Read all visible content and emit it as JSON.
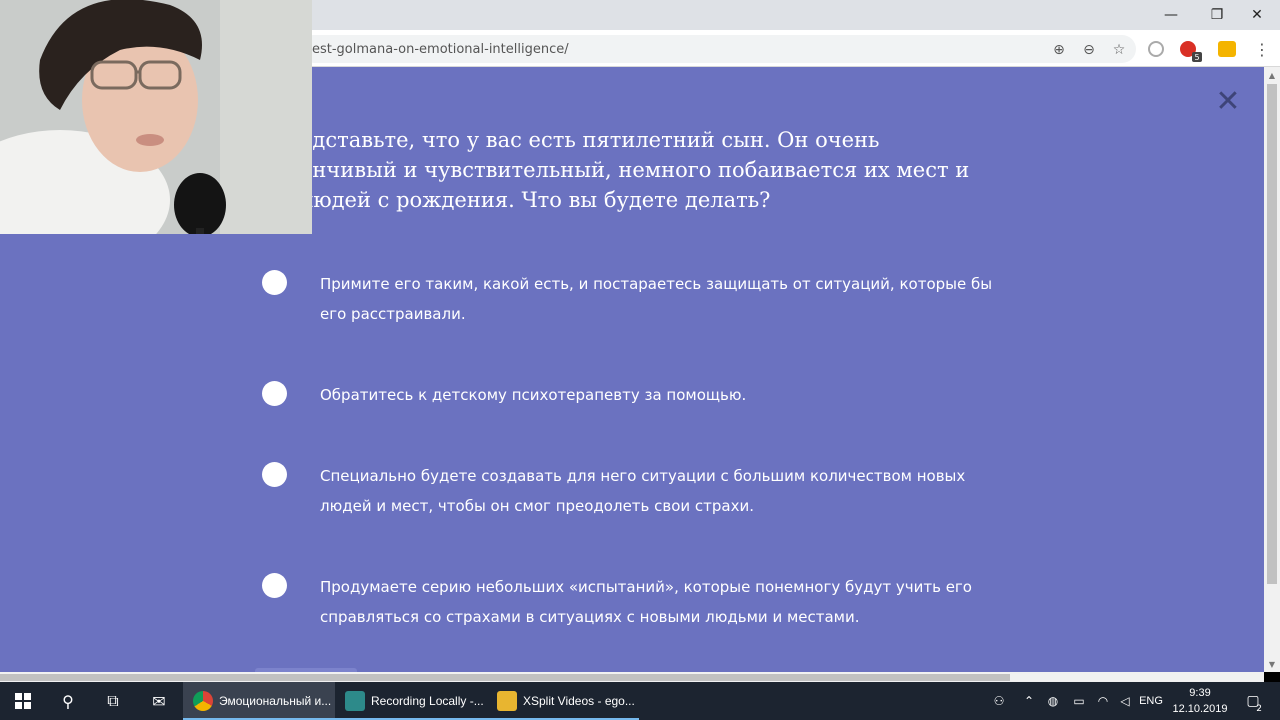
{
  "browser": {
    "url": "est-golmana-on-emotional-intelligence/",
    "window_controls": {
      "minimize": "—",
      "maximize": "❐",
      "close": "✕"
    }
  },
  "toolbar": {
    "install_icon": "⊕",
    "zoom_icon": "⊖",
    "star_icon": "☆",
    "extension_badge": "5",
    "menu_icon": "⋮"
  },
  "quiz": {
    "close_label": "✕",
    "question": "едставьте, что у вас есть пятилетний сын. Он очень енчивый и чувствительный, немного побаивается их мест и людей с рождения. Что вы будете делать?",
    "answers": [
      "Примите его таким, какой есть, и постараетесь защищать от ситуаций, которые бы его расстраивали.",
      "Обратитесь к детскому психотерапевту за помощью.",
      "Специально будете создавать для него ситуации с большим количеством новых людей и мест, чтобы он смог преодолеть свои страхи.",
      "Продумаете серию небольших «испытаний», которые понемногу будут учить его справляться со страхами в ситуациях с новыми людьми и местами."
    ]
  },
  "taskbar": {
    "apps": [
      {
        "label": "Эмоциональный и..."
      },
      {
        "label": "Recording Locally -..."
      },
      {
        "label": "XSplit Videos - ego..."
      }
    ],
    "tray": {
      "language": "ENG",
      "time": "9:39",
      "date": "12.10.2019",
      "notifications": "2"
    }
  }
}
